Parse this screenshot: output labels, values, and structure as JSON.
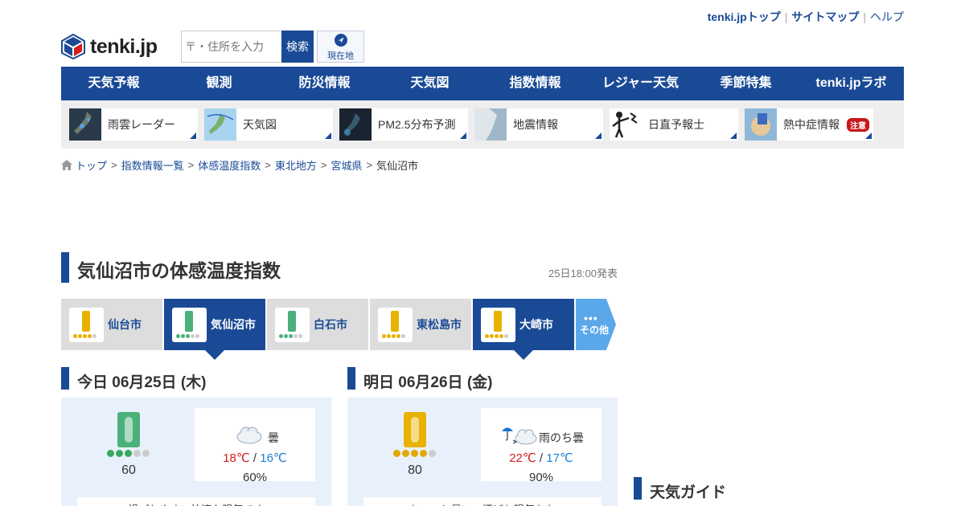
{
  "toplinks": {
    "top": "tenki.jpトップ",
    "sitemap": "サイトマップ",
    "help": "ヘルプ"
  },
  "logo": {
    "text": "tenki.jp"
  },
  "search": {
    "placeholder": "〒・住所を入力",
    "button": "検索",
    "location": "現在地"
  },
  "nav": [
    "天気予報",
    "観測",
    "防災情報",
    "天気図",
    "指数情報",
    "レジャー天気",
    "季節特集",
    "tenki.jpラボ"
  ],
  "tiles": [
    {
      "label": "雨雲レーダー"
    },
    {
      "label": "天気図"
    },
    {
      "label": "PM2.5分布予測"
    },
    {
      "label": "地震情報"
    },
    {
      "label": "日直予報士"
    },
    {
      "label": "熱中症情報",
      "badge": "注意"
    }
  ],
  "breadcrumb": [
    "トップ",
    "指数情報一覧",
    "体感温度指数",
    "東北地方",
    "宮城県",
    "気仙沼市"
  ],
  "page": {
    "title": "気仙沼市の体感温度指数",
    "issued": "25日18:00発表"
  },
  "city_tabs": [
    {
      "name": "仙台市",
      "level": 4,
      "color": "#e8b200",
      "active": false
    },
    {
      "name": "気仙沼市",
      "level": 3,
      "color": "#4cb07a",
      "active": true
    },
    {
      "name": "白石市",
      "level": 3,
      "color": "#4cb07a",
      "active": false
    },
    {
      "name": "東松島市",
      "level": 4,
      "color": "#e8b200",
      "active": false
    },
    {
      "name": "大崎市",
      "level": 4,
      "color": "#e8b200",
      "active": true
    }
  ],
  "other_label": "その他",
  "days": [
    {
      "heading": "今日 06月25日 (木)",
      "index": "60",
      "level": 3,
      "therm_color": "#4cb07a",
      "dot_color": "#3aa85e",
      "weather": "曇",
      "high": "18℃",
      "low": "16℃",
      "rain": "60%",
      "comment": "過ごしやすい快適な陽気です"
    },
    {
      "heading": "明日 06月26日 (金)",
      "index": "80",
      "level": 4,
      "therm_color": "#e8b200",
      "dot_color": "#e0a800",
      "weather": "雨のち曇",
      "high": "22℃",
      "low": "17℃",
      "rain": "90%",
      "comment": "ちょっと暑い、汗ばむ陽気かな"
    }
  ],
  "guide": {
    "title": "天気ガイド"
  },
  "colors": {
    "brand": "#1a4a96",
    "high": "#d41a1a",
    "low": "#1a7fd4"
  }
}
